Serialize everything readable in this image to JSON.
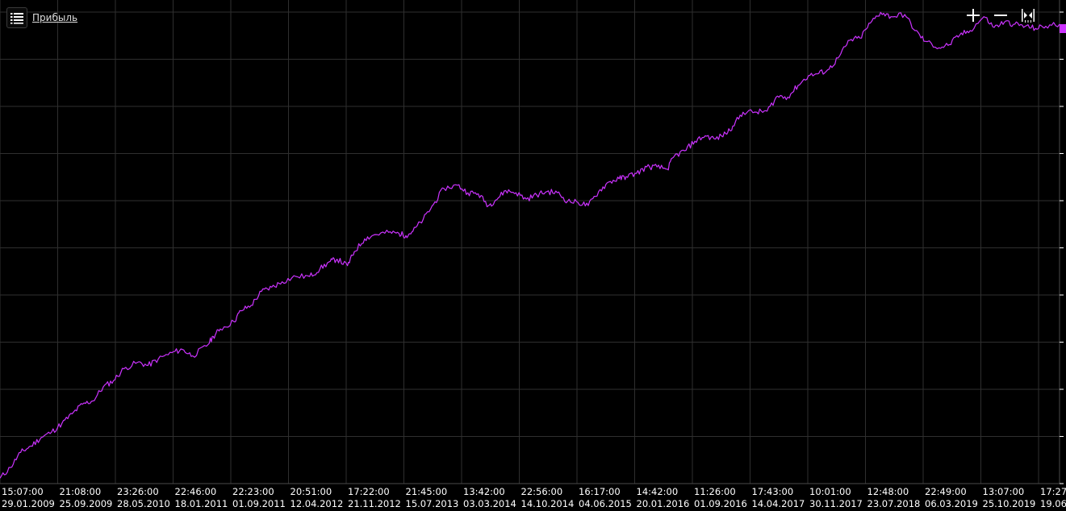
{
  "legend": {
    "label": "Прибыль",
    "icon": "list-icon"
  },
  "toolbar": {
    "zoom_in_icon": "plus-icon",
    "zoom_out_icon": "minus-icon",
    "fit_icon": "fit-width-icon"
  },
  "colors": {
    "background": "#000000",
    "grid": "#2f2f2f",
    "series": "#cc33ff",
    "text": "#ffffff"
  },
  "chart_data": {
    "type": "line",
    "grid": true,
    "x_ticks": [
      {
        "time": "15:07:00",
        "date": "29.01.2009"
      },
      {
        "time": "21:08:00",
        "date": "25.09.2009"
      },
      {
        "time": "23:26:00",
        "date": "28.05.2010"
      },
      {
        "time": "22:46:00",
        "date": "18.01.2011"
      },
      {
        "time": "22:23:00",
        "date": "01.09.2011"
      },
      {
        "time": "20:51:00",
        "date": "12.04.2012"
      },
      {
        "time": "17:22:00",
        "date": "21.11.2012"
      },
      {
        "time": "21:45:00",
        "date": "15.07.2013"
      },
      {
        "time": "13:42:00",
        "date": "03.03.2014"
      },
      {
        "time": "22:56:00",
        "date": "14.10.2014"
      },
      {
        "time": "16:17:00",
        "date": "04.06.2015"
      },
      {
        "time": "14:42:00",
        "date": "20.01.2016"
      },
      {
        "time": "11:26:00",
        "date": "01.09.2016"
      },
      {
        "time": "17:43:00",
        "date": "14.04.2017"
      },
      {
        "time": "10:01:00",
        "date": "30.11.2017"
      },
      {
        "time": "12:48:00",
        "date": "23.07.2018"
      },
      {
        "time": "22:49:00",
        "date": "06.03.2019"
      },
      {
        "time": "13:07:00",
        "date": "25.10.2019"
      },
      {
        "time": "17:27",
        "date": "19.06"
      }
    ],
    "y_grid_count": 10,
    "series": [
      {
        "color": "#cc33ff",
        "values": [
          [
            0.0,
            0.2
          ],
          [
            0.3,
            1.2
          ],
          [
            0.6,
            2.6
          ],
          [
            0.9,
            3.2
          ],
          [
            1.2,
            4.0
          ],
          [
            1.5,
            4.5
          ],
          [
            1.8,
            5.3
          ],
          [
            2.1,
            6.2
          ],
          [
            2.4,
            7.1
          ],
          [
            2.7,
            7.4
          ],
          [
            3.0,
            8.7
          ],
          [
            3.3,
            9.3
          ],
          [
            3.6,
            10.4
          ],
          [
            4.0,
            11.0
          ],
          [
            4.3,
            10.7
          ],
          [
            4.6,
            11.3
          ],
          [
            5.0,
            11.9
          ],
          [
            5.3,
            12.2
          ],
          [
            5.6,
            11.6
          ],
          [
            6.0,
            12.5
          ],
          [
            6.2,
            13.4
          ],
          [
            6.4,
            14.1
          ],
          [
            6.8,
            14.8
          ],
          [
            7.0,
            15.8
          ],
          [
            7.3,
            16.3
          ],
          [
            7.6,
            17.6
          ],
          [
            7.9,
            18.0
          ],
          [
            8.2,
            18.5
          ],
          [
            8.6,
            19.0
          ],
          [
            9.0,
            19.0
          ],
          [
            9.3,
            19.7
          ],
          [
            9.6,
            20.4
          ],
          [
            9.8,
            20.6
          ],
          [
            10.1,
            20.0
          ],
          [
            10.3,
            21.3
          ],
          [
            10.6,
            22.5
          ],
          [
            10.9,
            22.9
          ],
          [
            11.3,
            23.1
          ],
          [
            11.6,
            23.0
          ],
          [
            11.8,
            22.8
          ],
          [
            12.0,
            23.2
          ],
          [
            12.3,
            24.3
          ],
          [
            12.6,
            25.7
          ],
          [
            12.9,
            27.2
          ],
          [
            13.3,
            27.5
          ],
          [
            13.6,
            26.8
          ],
          [
            13.9,
            26.7
          ],
          [
            14.2,
            25.6
          ],
          [
            14.4,
            26.1
          ],
          [
            14.7,
            27.0
          ],
          [
            15.0,
            26.8
          ],
          [
            15.3,
            26.2
          ],
          [
            15.6,
            26.6
          ],
          [
            15.9,
            26.9
          ],
          [
            16.2,
            26.8
          ],
          [
            16.5,
            26.0
          ],
          [
            16.8,
            25.9
          ],
          [
            17.1,
            25.6
          ],
          [
            17.4,
            26.9
          ],
          [
            17.7,
            27.8
          ],
          [
            18.0,
            28.1
          ],
          [
            18.2,
            28.3
          ],
          [
            18.5,
            28.6
          ],
          [
            18.8,
            29.2
          ],
          [
            19.1,
            29.2
          ],
          [
            19.4,
            29.0
          ],
          [
            19.6,
            30.2
          ],
          [
            19.9,
            30.7
          ],
          [
            20.2,
            31.6
          ],
          [
            20.5,
            32.1
          ],
          [
            20.8,
            31.8
          ],
          [
            21.1,
            32.3
          ],
          [
            21.3,
            33.0
          ],
          [
            21.6,
            34.3
          ],
          [
            22.0,
            34.3
          ],
          [
            22.3,
            34.4
          ],
          [
            22.6,
            35.8
          ],
          [
            22.9,
            35.7
          ],
          [
            23.2,
            36.8
          ],
          [
            23.5,
            37.7
          ],
          [
            23.8,
            37.9
          ],
          [
            24.1,
            38.3
          ],
          [
            24.4,
            39.5
          ],
          [
            24.7,
            41.0
          ],
          [
            25.0,
            41.2
          ],
          [
            25.3,
            42.6
          ],
          [
            25.6,
            43.6
          ],
          [
            25.9,
            43.2
          ],
          [
            26.3,
            43.4
          ],
          [
            26.6,
            41.9
          ],
          [
            26.9,
            40.9
          ],
          [
            27.3,
            40.3
          ],
          [
            27.6,
            40.6
          ],
          [
            27.9,
            41.5
          ],
          [
            28.2,
            41.9
          ],
          [
            28.6,
            43.2
          ],
          [
            28.9,
            42.2
          ],
          [
            29.2,
            42.7
          ],
          [
            29.5,
            42.5
          ],
          [
            29.8,
            42.3
          ],
          [
            30.1,
            42.1
          ],
          [
            30.4,
            42.3
          ],
          [
            30.8,
            42.5
          ]
        ]
      }
    ]
  }
}
